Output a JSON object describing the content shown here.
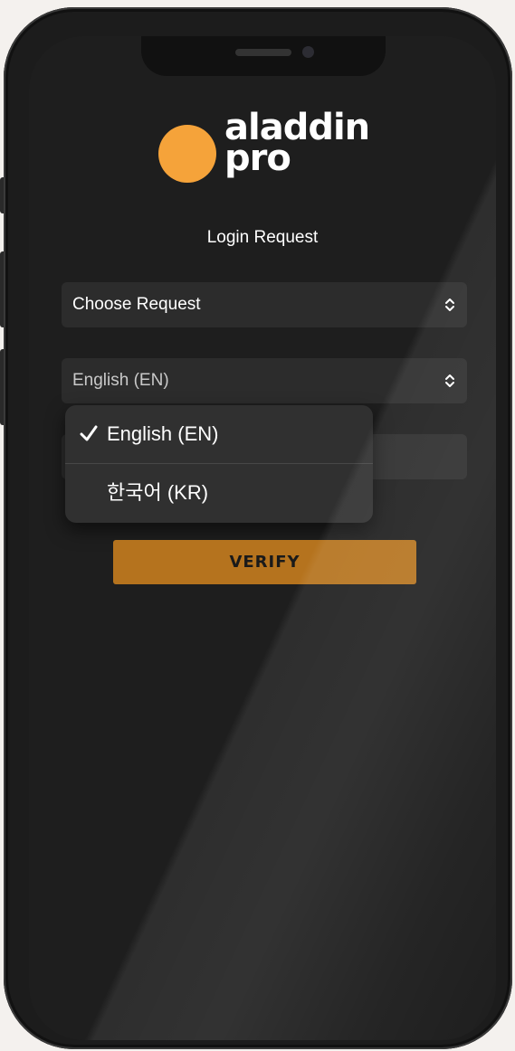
{
  "app": {
    "brand_line1": "aladdin",
    "brand_line2": "pro",
    "brand_color": "#f5a33a"
  },
  "screen": {
    "title": "Login Request"
  },
  "request_select": {
    "value": "Choose Request",
    "icon": "chevron-updown-icon"
  },
  "language_select": {
    "value": "English (EN)",
    "icon": "chevron-updown-icon",
    "options": [
      {
        "label": "English (EN)",
        "selected": true,
        "icon": "checkmark-icon"
      },
      {
        "label": "한국어 (KR)",
        "selected": false
      }
    ]
  },
  "verify_button": {
    "label": "VERIFY",
    "color": "#b5731e"
  }
}
